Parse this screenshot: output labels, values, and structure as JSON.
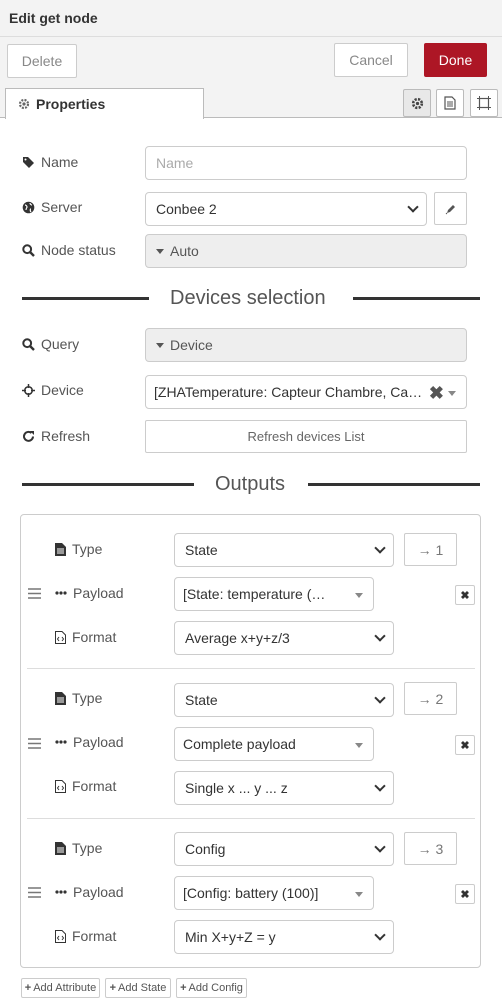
{
  "dialog": {
    "title": "Edit get node"
  },
  "toolbar": {
    "delete_label": "Delete",
    "cancel_label": "Cancel",
    "done_label": "Done"
  },
  "tabs": {
    "properties_label": "Properties"
  },
  "fields": {
    "name": {
      "label": "Name",
      "placeholder": "Name",
      "value": ""
    },
    "server": {
      "label": "Server",
      "value": "Conbee 2"
    },
    "node_status": {
      "label": "Node status",
      "value": "Auto"
    }
  },
  "sections": {
    "devices": "Devices selection",
    "outputs": "Outputs"
  },
  "devices": {
    "query": {
      "label": "Query",
      "value": "Device"
    },
    "device": {
      "label": "Device",
      "value": "[ZHATemperature: Capteur Chambre, Ca…"
    },
    "refresh": {
      "label": "Refresh",
      "button_label": "Refresh devices List"
    }
  },
  "outputs": [
    {
      "type_label": "Type",
      "type_value": "State",
      "port": "→ 1",
      "payload_label": "Payload",
      "payload_value": "[State: temperature (…",
      "format_label": "Format",
      "format_value": "Average x+y+z/3"
    },
    {
      "type_label": "Type",
      "type_value": "State",
      "port": "→ 2",
      "payload_label": "Payload",
      "payload_value": "Complete payload",
      "format_label": "Format",
      "format_value": "Single x ... y ... z"
    },
    {
      "type_label": "Type",
      "type_value": "Config",
      "port": "→ 3",
      "payload_label": "Payload",
      "payload_value": "[Config: battery (100)]",
      "format_label": "Format",
      "format_value": "Min X+y+Z = y"
    }
  ],
  "footer": {
    "add_attribute": "Add Attribute",
    "add_state": "Add State",
    "add_config": "Add Config"
  },
  "colors": {
    "primary": "#ad1625"
  }
}
